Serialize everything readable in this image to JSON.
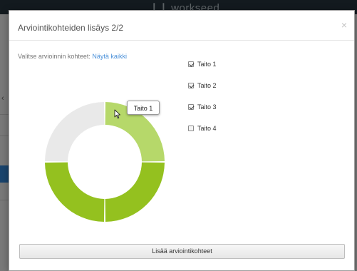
{
  "background": {
    "logo_text": "workseed"
  },
  "modal": {
    "title": "Arviointikohteiden lisäys 2/2",
    "close_symbol": "×",
    "instruction_label": "Valitse arvioinnin kohteet:",
    "show_all_link": "Näytä kaikki",
    "tooltip": "Taito 1",
    "checklist": [
      {
        "label": "Taito 1",
        "checked": true
      },
      {
        "label": "Taito 2",
        "checked": true
      },
      {
        "label": "Taito 3",
        "checked": true
      },
      {
        "label": "Taito 4",
        "checked": false
      }
    ],
    "submit_button": "Lisää arviointikohteet"
  },
  "chart_data": {
    "type": "pie",
    "style": "donut",
    "categories": [
      "Taito 1",
      "Taito 2",
      "Taito 3",
      "Taito 4"
    ],
    "values": [
      25,
      25,
      25,
      25
    ],
    "colors": [
      "#b6d86a",
      "#94c11f",
      "#94c11f",
      "#e9e9e9"
    ],
    "highlighted": "Taito 1"
  },
  "icons": {
    "cursor": "mouse-pointer-icon",
    "close": "close-icon"
  }
}
